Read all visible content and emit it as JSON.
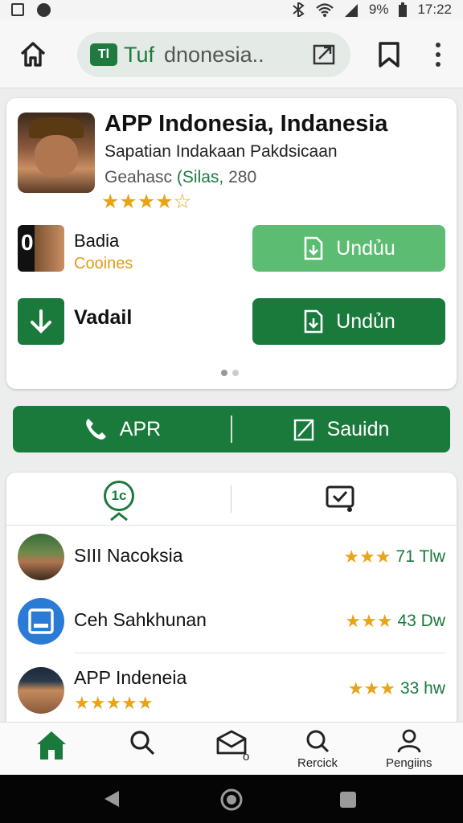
{
  "status_bar": {
    "battery": "9%",
    "time": "17:22"
  },
  "top_bar": {
    "url_logo": "Tl",
    "url_brand": "Tuf",
    "url_text": "dnonesia.."
  },
  "app_card": {
    "title": "APP Indonesia, Indanesia",
    "subtitle": "Sapatian Indakaan Pakdsicaan",
    "meta_prefix": "Geahasc",
    "meta_highlight": "(Silas,",
    "meta_count": "280",
    "rating_stars": "★★★★☆",
    "rows": [
      {
        "name": "Badia",
        "sub": "Cooines",
        "thumb_digit": "0",
        "button": "Undủu"
      },
      {
        "name": "Vadail",
        "button": "Undủn"
      }
    ]
  },
  "action_bar": {
    "left_label": "APR",
    "right_label": "Sauidn"
  },
  "tabs": {
    "tab_a_label": "1c"
  },
  "list": [
    {
      "name": "SIII Nacoksia",
      "stars": "★★★",
      "meta": "71 Tlw"
    },
    {
      "name": "Ceh Sahkhunan",
      "stars": "★★★",
      "meta": "43 Dw"
    },
    {
      "name": "APP Indeneia",
      "stars": "★★★",
      "meta": "33 hw",
      "sub_stars": "★★★★★"
    }
  ],
  "bottom_nav": {
    "items": [
      {
        "label": "",
        "icon": "home-icon"
      },
      {
        "label": "",
        "icon": "search-icon"
      },
      {
        "label": "o",
        "icon": "mail-icon"
      },
      {
        "label": "Rercick",
        "icon": "search-icon"
      },
      {
        "label": "Pengiins",
        "icon": "person-icon"
      }
    ]
  },
  "colors": {
    "accent": "#1a7a3c",
    "accent_light": "#5cbd72",
    "star": "#e8a417",
    "sub_orange": "#e39b12"
  }
}
